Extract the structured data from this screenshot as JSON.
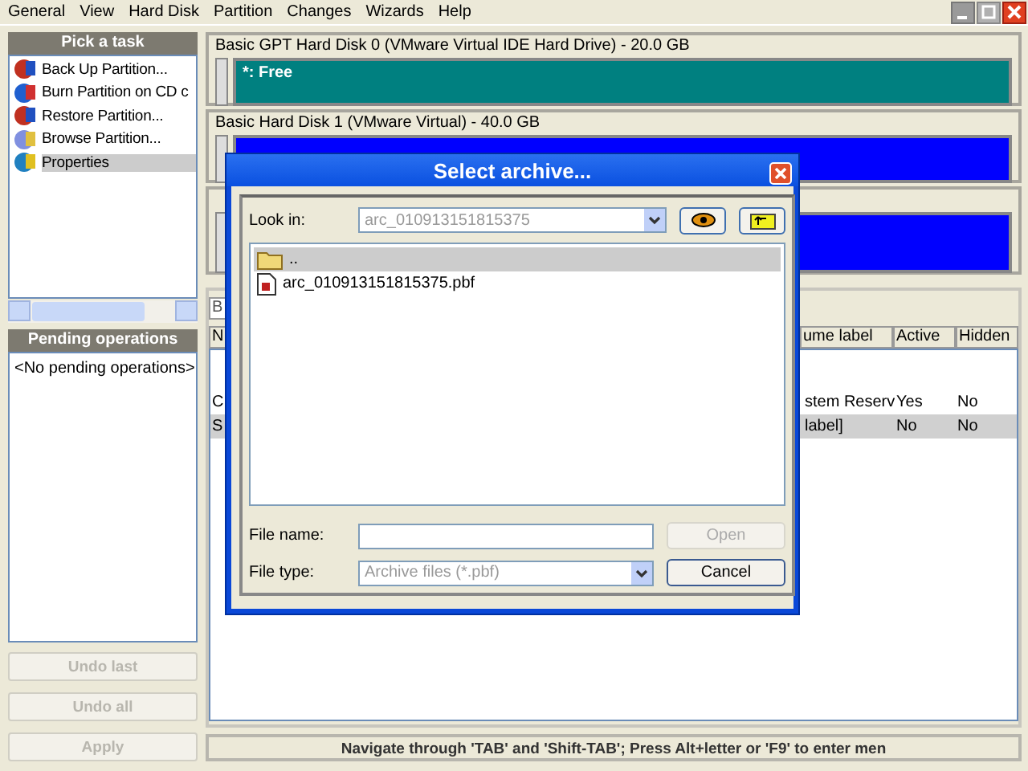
{
  "menu": [
    "General",
    "View",
    "Hard Disk",
    "Partition",
    "Changes",
    "Wizards",
    "Help"
  ],
  "tasks": {
    "title": "Pick a task",
    "items": [
      {
        "label": "Back Up Partition...",
        "kind": "backup",
        "selected": false
      },
      {
        "label": "Burn Partition on CD c",
        "kind": "burn",
        "selected": false
      },
      {
        "label": "Restore Partition...",
        "kind": "restore",
        "selected": false
      },
      {
        "label": "Browse Partition...",
        "kind": "browse",
        "selected": false
      },
      {
        "label": "Properties",
        "kind": "properties",
        "selected": true
      }
    ]
  },
  "pending": {
    "title": "Pending operations",
    "items": [
      "<No pending operations>"
    ]
  },
  "actions": [
    {
      "label": "Undo last",
      "disabled": true
    },
    {
      "label": "Undo all",
      "disabled": true
    },
    {
      "label": "Apply",
      "disabled": true
    }
  ],
  "disks": [
    {
      "title": "Basic GPT Hard Disk 0 (VMware Virtual IDE Hard Drive) - 20.0 GB",
      "partition": {
        "label": "*: Free",
        "color": "#008080"
      }
    },
    {
      "title": "Basic Hard Disk 1 (VMware Virtual) - 40.0 GB",
      "partition": {
        "color": "#0000ff"
      }
    },
    {
      "partition": {
        "color": "#0000ff"
      }
    }
  ],
  "table": {
    "field": "B",
    "columns": [
      "N",
      "ume label",
      "Active",
      "Hidden"
    ],
    "rows": [
      {
        "cells": [
          "C",
          "stem Reserv",
          "Yes",
          "No"
        ],
        "selected": false
      },
      {
        "cells": [
          "S",
          "label]",
          "No",
          "No"
        ],
        "selected": true
      }
    ]
  },
  "status_bar": "Navigate through 'TAB' and 'Shift-TAB'; Press Alt+letter or 'F9' to enter men",
  "dialog": {
    "title": "Select archive...",
    "look_in": {
      "label": "Look in:",
      "value": "arc_010913151815375"
    },
    "files": [
      {
        "name": "..",
        "kind": "folder",
        "selected": true
      },
      {
        "name": "arc_010913151815375.pbf",
        "kind": "file",
        "selected": false
      }
    ],
    "file_name": {
      "label": "File name:"
    },
    "file_type": {
      "label": "File type:",
      "value": "Archive files (*.pbf)",
      "disabled": true
    },
    "buttons": [
      {
        "label": "Open",
        "disabled": true
      },
      {
        "label": "Cancel",
        "disabled": false
      }
    ]
  }
}
